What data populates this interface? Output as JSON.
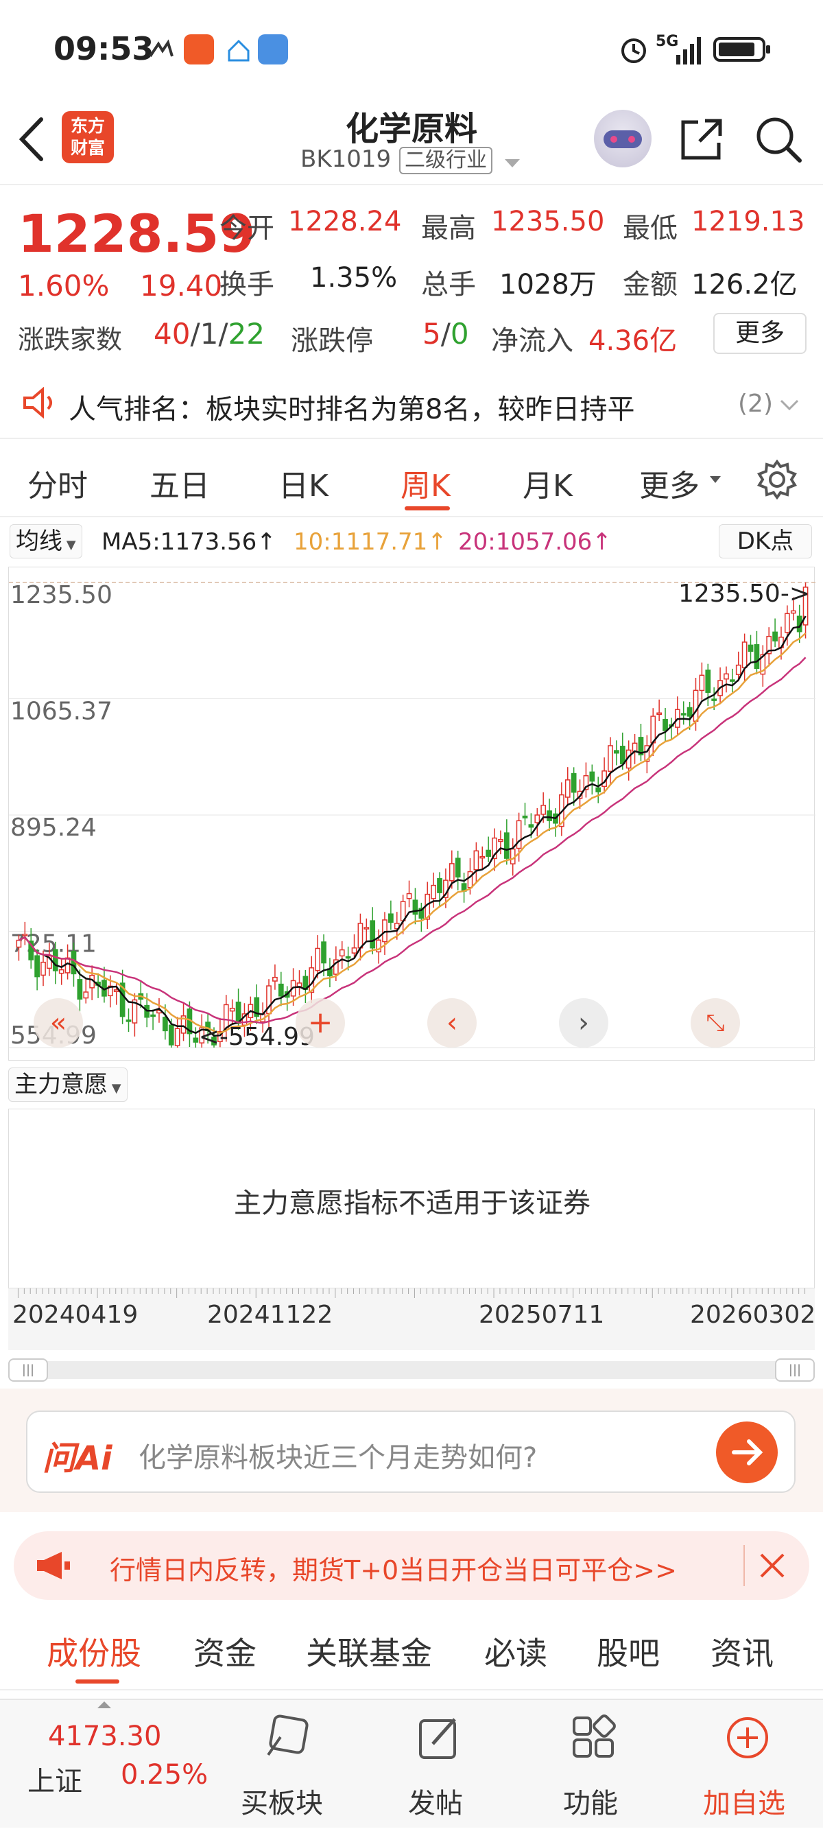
{
  "status_bar": {
    "time": "09:53",
    "network": "5G"
  },
  "header": {
    "back_icon": "chevron-left-icon",
    "logo_text_line1": "东方",
    "logo_text_line2": "财富",
    "title": "化学原料",
    "code": "BK1019",
    "category_badge": "二级行业",
    "share_icon": "share-icon",
    "search_icon": "search-icon"
  },
  "quote": {
    "price": "1228.59",
    "change_pct": "1.60%",
    "change": "19.40",
    "open_label": "今开",
    "open": "1228.24",
    "high_label": "最高",
    "high": "1235.50",
    "low_label": "最低",
    "low": "1219.13",
    "turnover_label": "换手",
    "turnover": "1.35%",
    "volume_label": "总手",
    "volume": "1028万",
    "amount_label": "金额",
    "amount": "126.2亿",
    "updown_label": "涨跌家数",
    "up_count": "40",
    "slash1": "/",
    "flat_count": "1",
    "slash2": "/",
    "down_count": "22",
    "limit_label": "涨跌停",
    "limit_up": "5",
    "slash3": "/",
    "limit_down": "0",
    "inflow_label": "净流入",
    "inflow": "4.36亿",
    "more_button": "更多"
  },
  "notice": {
    "text": "人气排名：板块实时排名为第8名，较昨日持平",
    "count": "(2)"
  },
  "period_tabs": [
    {
      "label": "分时",
      "active": false
    },
    {
      "label": "五日",
      "active": false
    },
    {
      "label": "日K",
      "active": false
    },
    {
      "label": "周K",
      "active": true
    },
    {
      "label": "月K",
      "active": false
    },
    {
      "label": "更多",
      "active": false
    }
  ],
  "ma_bar": {
    "selector": "均线",
    "ma5": "MA5:1173.56↑",
    "ma10": "10:1117.71↑",
    "ma20": "20:1057.06↑",
    "dk_button": "DK点"
  },
  "chart_data": {
    "type": "candlestick",
    "y_labels": [
      "1235.50",
      "1065.37",
      "895.24",
      "725.11",
      "554.99"
    ],
    "ylim": [
      554.99,
      1235.5
    ],
    "max_annotation": "1235.50->",
    "min_annotation": "<-554.99",
    "x_labels": [
      "20240419",
      "20241122",
      "20250711",
      "20260302"
    ],
    "series": [
      {
        "name": "MA5",
        "color": "#111111"
      },
      {
        "name": "MA10",
        "color": "#e8a23a"
      },
      {
        "name": "MA20",
        "color": "#c8337a"
      }
    ],
    "up_color": "#e0322b",
    "down_color": "#2fa12f"
  },
  "indicator": {
    "selector": "主力意愿",
    "message": "主力意愿指标不适用于该证券"
  },
  "ai": {
    "logo": "问Ai",
    "question": "化学原料板块近三个月走势如何?"
  },
  "promo": {
    "text": "行情日内反转，期货T+0当日开仓当日可平仓>>"
  },
  "bottom_tabs": [
    {
      "label": "成份股",
      "active": true
    },
    {
      "label": "资金",
      "active": false
    },
    {
      "label": "关联基金",
      "active": false
    },
    {
      "label": "必读",
      "active": false
    },
    {
      "label": "股吧",
      "active": false
    },
    {
      "label": "资讯",
      "active": false
    }
  ],
  "bottom_bar": {
    "index_value": "4173.30",
    "index_name": "上证",
    "index_change": "0.25%",
    "buttons": [
      "买板块",
      "发帖",
      "功能",
      "加自选"
    ]
  }
}
